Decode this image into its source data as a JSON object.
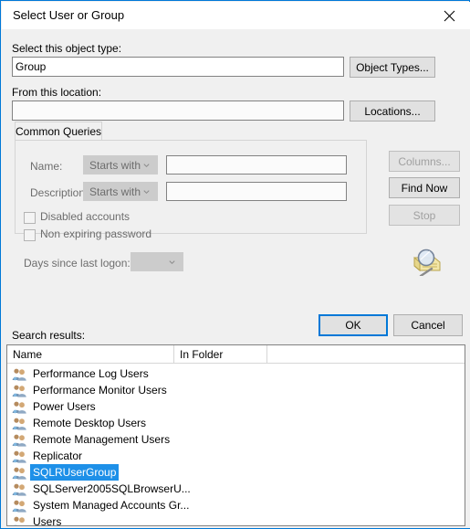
{
  "window": {
    "title": "Select User or Group",
    "close_label": "✕",
    "accent_color": "#0078d7",
    "background": "#f0f0f0"
  },
  "object_type": {
    "label": "Select this object type:",
    "value": "Group",
    "button": "Object Types..."
  },
  "location": {
    "label": "From this location:",
    "value": "",
    "button": "Locations..."
  },
  "common_queries": {
    "tab_label": "Common Queries",
    "name": {
      "label": "Name:",
      "condition": "Starts with",
      "value": ""
    },
    "description": {
      "label": "Description:",
      "condition": "Starts with",
      "value": ""
    },
    "disabled_accounts": {
      "label": "Disabled accounts",
      "checked": false
    },
    "non_expiring_password": {
      "label": "Non expiring password",
      "checked": false
    },
    "days_since_last_logon": {
      "label": "Days since last logon:",
      "value": ""
    }
  },
  "side_buttons": {
    "columns": "Columns...",
    "find_now": "Find Now",
    "stop": "Stop"
  },
  "dialog_buttons": {
    "ok": "OK",
    "cancel": "Cancel"
  },
  "search_results": {
    "label": "Search results:",
    "columns": [
      "Name",
      "In Folder"
    ],
    "selection_color": "#1e90e8",
    "rows": [
      {
        "name": "Performance Log Users",
        "in_folder": ""
      },
      {
        "name": "Performance Monitor Users",
        "in_folder": ""
      },
      {
        "name": "Power Users",
        "in_folder": ""
      },
      {
        "name": "Remote Desktop Users",
        "in_folder": ""
      },
      {
        "name": "Remote Management Users",
        "in_folder": ""
      },
      {
        "name": "Replicator",
        "in_folder": ""
      },
      {
        "name": "SQLRUserGroup",
        "in_folder": ""
      },
      {
        "name": "SQLServer2005SQLBrowserU...",
        "in_folder": ""
      },
      {
        "name": "System Managed Accounts Gr...",
        "in_folder": ""
      },
      {
        "name": "Users",
        "in_folder": ""
      }
    ],
    "selected_index": 6
  }
}
